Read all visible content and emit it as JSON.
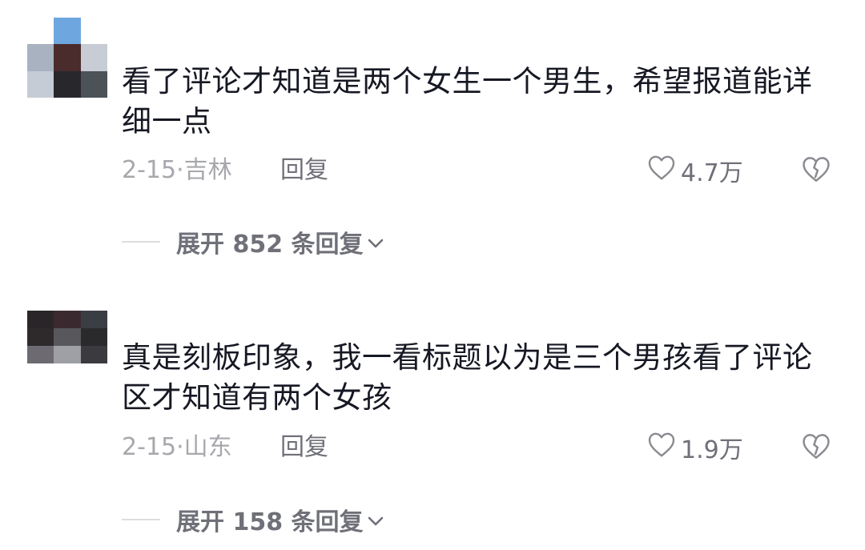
{
  "comments": [
    {
      "username": "",
      "text": "看了评论才知道是两个女生一个男生，希望报道能详细一点",
      "date": "2-15·",
      "location": "吉林",
      "reply_label": "回复",
      "likes": "4.7万",
      "expand_label": "展开 852 条回复",
      "avatar_colors": [
        "#ffffff",
        "#6ea7e0",
        "#ffffff",
        "#a9b2c0",
        "#4a2c2c",
        "#c8ccd4",
        "#c6ccd6",
        "#27272c",
        "#4b5258"
      ]
    },
    {
      "username": "",
      "text": "真是刻板印象，我一看标题以为是三个男孩看了评论区才知道有两个女孩",
      "date": "2-15·",
      "location": "山东",
      "reply_label": "回复",
      "likes": "1.9万",
      "expand_label": "展开 158 条回复",
      "avatar_colors": [
        "#2a2528",
        "#3a2a30",
        "#3a3d44",
        "#3b3a3e",
        "#2e2a2c",
        "#57575c",
        "#2a2a2d",
        "#6d6a72",
        "#9ea0a6"
      ]
    }
  ],
  "icons": {
    "like": "heart-outline-icon",
    "dislike": "broken-heart-icon",
    "expand": "chevron-down-icon"
  }
}
